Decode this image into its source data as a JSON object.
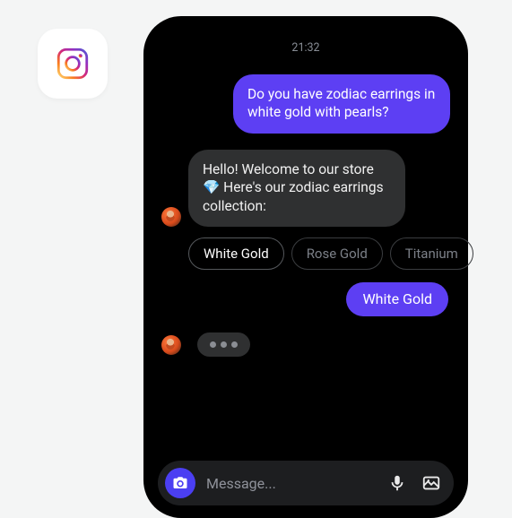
{
  "brand_icon": "instagram-icon",
  "chat": {
    "timestamp": "21:32",
    "user_message": "Do you have zodiac earrings in white gold with pearls?",
    "bot_message": "Hello! Welcome to our store 💎 Here's our zodiac earrings collection:",
    "option_chips": [
      {
        "label": "White Gold",
        "active": true
      },
      {
        "label": "Rose Gold",
        "active": false
      },
      {
        "label": "Titanium",
        "active": false
      }
    ],
    "user_selection": "White Gold"
  },
  "composer": {
    "placeholder": "Message..."
  },
  "colors": {
    "accent": "#5d3ff3",
    "phone_bg": "#000000",
    "recv_bubble": "#2f3031"
  }
}
